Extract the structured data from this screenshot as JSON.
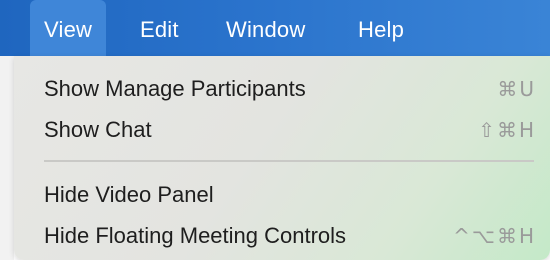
{
  "menubar": {
    "items": [
      {
        "label": "View",
        "active": true
      },
      {
        "label": "Edit",
        "active": false
      },
      {
        "label": "Window",
        "active": false
      },
      {
        "label": "Help",
        "active": false
      }
    ]
  },
  "menu": {
    "items": [
      {
        "label": "Show Manage Participants",
        "shortcut": "⌘U"
      },
      {
        "label": "Show Chat",
        "shortcut": "⇧⌘H"
      },
      {
        "label": "Hide Video Panel",
        "shortcut": ""
      },
      {
        "label": "Hide Floating Meeting Controls",
        "shortcut": "^⌥⌘H"
      }
    ]
  },
  "colors": {
    "menubar": "#2a73cc",
    "menubar_active": "#3f86d8",
    "menu_text": "#1e1e1e",
    "shortcut_text": "#9a9a9a"
  }
}
